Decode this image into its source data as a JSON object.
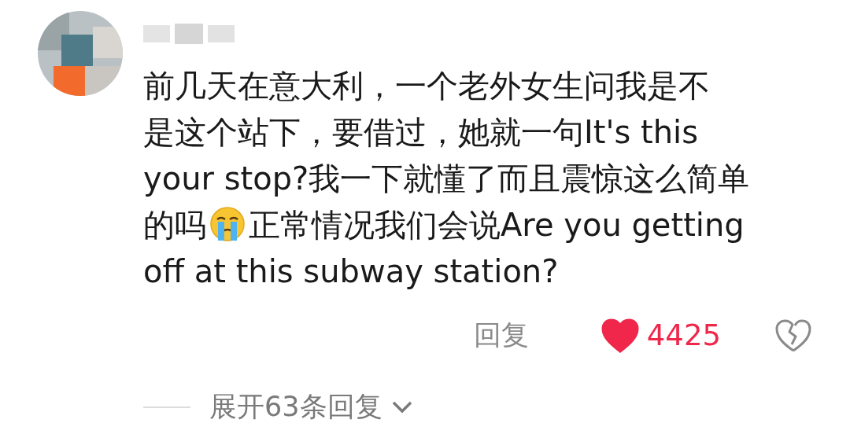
{
  "comment": {
    "lines": [
      {
        "kind": "plain",
        "text": "前几天在意大利，一个老外女生问我是不"
      },
      {
        "kind": "plain",
        "text": "是这个站下，要借过，她就一句It's this"
      },
      {
        "kind": "plain",
        "text": "your stop?我一下就懂了而且震惊这么简单"
      },
      {
        "kind": "emoji",
        "text": "的吗",
        "text_after_icon": "正常情况我们会说Are you getting"
      },
      {
        "kind": "plain",
        "text": "off at this subway station?"
      }
    ],
    "reply_label": "回复",
    "liked": true,
    "like_count": "4425"
  },
  "expand_replies": {
    "label": "展开63条回复"
  }
}
